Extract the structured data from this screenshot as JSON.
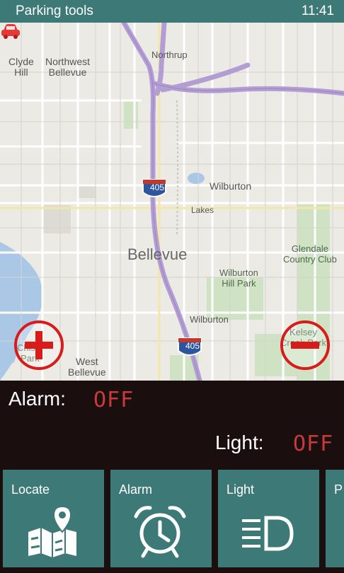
{
  "header": {
    "title": "Parking tools",
    "time": "11:41"
  },
  "map": {
    "labels": {
      "clyde_hill": "Clyde\nHill",
      "northwest_bellevue": "Northwest\nBellevue",
      "northrup": "Northrup",
      "wilburton_top": "Wilburton",
      "lakes": "Lakes",
      "bellevue": "Bellevue",
      "glendale": "Glendale\nCountry Club",
      "wilburton_hill_park": "Wilburton\nHill Park",
      "wilburton_bottom": "Wilburton",
      "kelsey_creek_park": "Kelsey\nCreek Park",
      "chism_park": "Chism\nPark",
      "west_bellevue": "West\nBellevue",
      "highway_405_top": "405",
      "highway_405_bottom": "405"
    }
  },
  "status": {
    "alarm_label": "Alarm:",
    "alarm_value": "OFF",
    "light_label": "Light:",
    "light_value": "OFF"
  },
  "tiles": [
    {
      "label": "Locate",
      "icon": "map-marker-icon"
    },
    {
      "label": "Alarm",
      "icon": "alarm-clock-icon"
    },
    {
      "label": "Light",
      "icon": "headlight-icon"
    },
    {
      "label": "P",
      "icon": ""
    }
  ],
  "colors": {
    "accent": "#3d7a77",
    "status_background": "#1a0e0e",
    "off_value": "#c93a3a",
    "zoom_red": "#d81b1b",
    "highway": "#b39ed3"
  }
}
